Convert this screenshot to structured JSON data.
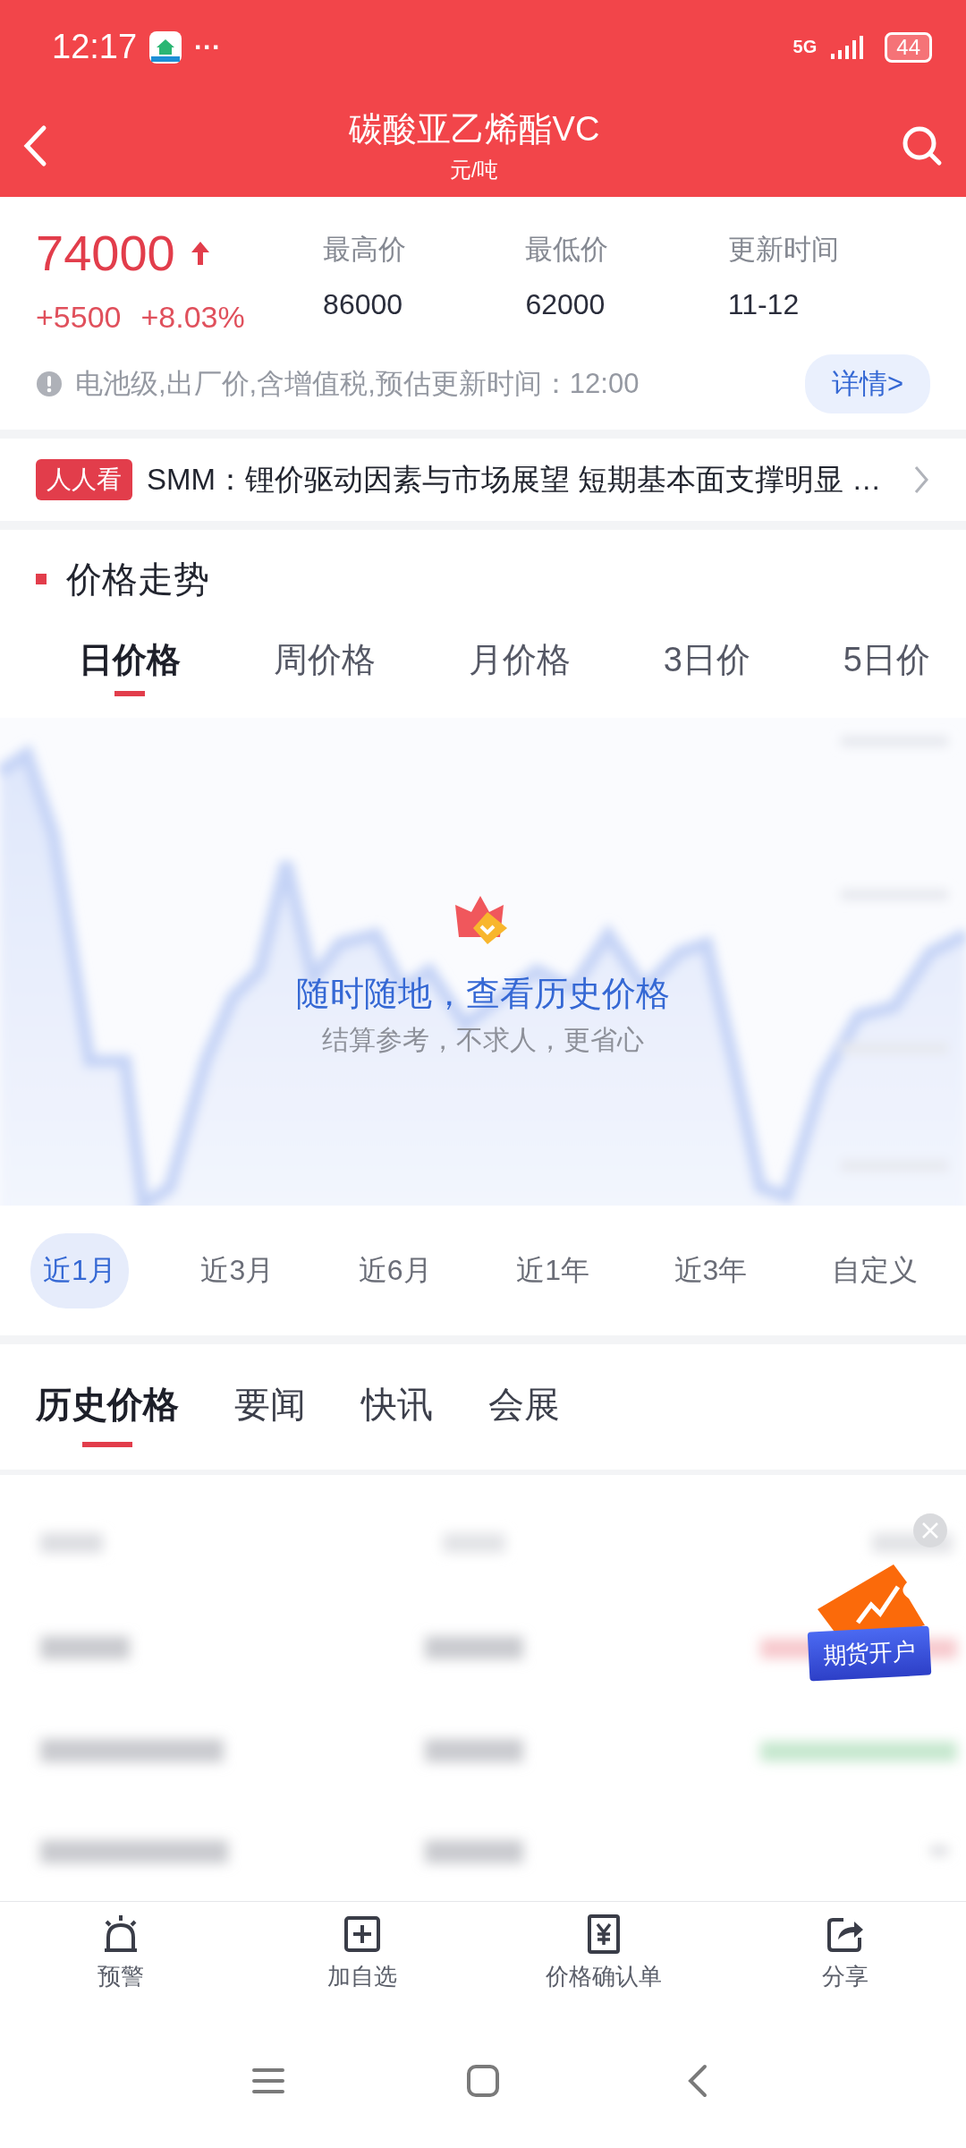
{
  "status_bar": {
    "time": "12:17",
    "more": "···",
    "network": "5G",
    "battery": "44"
  },
  "header": {
    "title": "碳酸亚乙烯酯VC",
    "unit": "元/吨"
  },
  "quote": {
    "price": "74000",
    "rising": true,
    "change": "+5500",
    "change_pct": "+8.03%"
  },
  "stats": [
    {
      "label": "最高价",
      "value": "86000"
    },
    {
      "label": "最低价",
      "value": "62000"
    },
    {
      "label": "更新时间",
      "value": "11-12"
    }
  ],
  "notice": {
    "text": "电池级,出厂价,含增值税,预估更新时间：12:00",
    "button": "详情>"
  },
  "news": {
    "tag": "人人看",
    "text": "SMM：锂价驱动因素与市场展望 短期基本面支撑明显 …"
  },
  "trend": {
    "title": "价格走势",
    "period_tabs": [
      {
        "label": "日价格",
        "selected": true
      },
      {
        "label": "周价格",
        "selected": false
      },
      {
        "label": "月价格",
        "selected": false
      },
      {
        "label": "3日价",
        "selected": false
      },
      {
        "label": "5日价",
        "selected": false
      }
    ],
    "promo_title": "随时随地，查看历史价格",
    "promo_subtitle": "结算参考，不求人，更省心",
    "ranges": [
      {
        "label": "近1月",
        "selected": true
      },
      {
        "label": "近3月",
        "selected": false
      },
      {
        "label": "近6月",
        "selected": false
      },
      {
        "label": "近1年",
        "selected": false
      },
      {
        "label": "近3年",
        "selected": false
      },
      {
        "label": "自定义",
        "selected": false
      }
    ]
  },
  "content_tabs": [
    {
      "label": "历史价格",
      "selected": true
    },
    {
      "label": "要闻",
      "selected": false
    },
    {
      "label": "快讯",
      "selected": false
    },
    {
      "label": "会展",
      "selected": false
    }
  ],
  "floating_ad": {
    "label": "期货开户"
  },
  "bottom_nav": [
    {
      "label": "预警"
    },
    {
      "label": "加自选"
    },
    {
      "label": "价格确认单"
    },
    {
      "label": "分享"
    }
  ]
}
